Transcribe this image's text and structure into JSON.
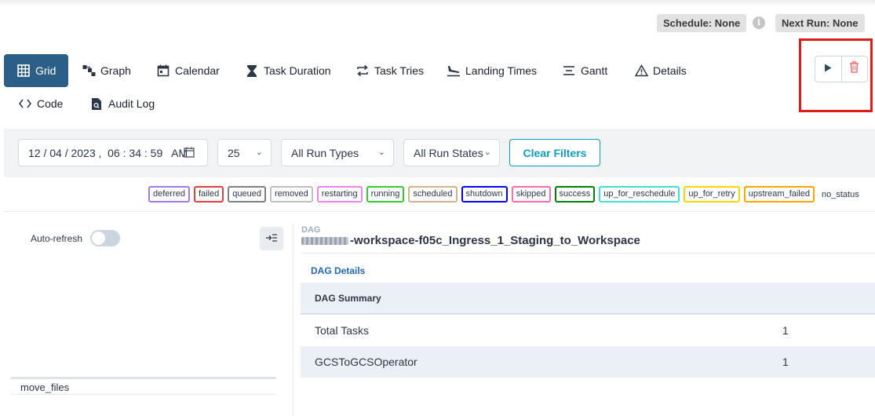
{
  "header": {
    "schedule": "Schedule: None",
    "next_run": "Next Run: None"
  },
  "nav": {
    "grid": "Grid",
    "graph": "Graph",
    "calendar": "Calendar",
    "task_duration": "Task Duration",
    "task_tries": "Task Tries",
    "landing_times": "Landing Times",
    "gantt": "Gantt",
    "details": "Details",
    "code": "Code",
    "audit_log": "Audit Log",
    "active": "Grid"
  },
  "filters": {
    "datetime": "12 / 04 / 2023 ,  06 : 34 : 59   AM",
    "num_runs": "25",
    "run_types": "All Run Types",
    "run_states": "All Run States",
    "clear": "Clear Filters"
  },
  "legend": {
    "states": [
      {
        "label": "deferred",
        "color": "#9f7aea"
      },
      {
        "label": "failed",
        "color": "#e53e3e"
      },
      {
        "label": "queued",
        "color": "#808080"
      },
      {
        "label": "removed",
        "color": "#c0c0c0"
      },
      {
        "label": "restarting",
        "color": "#ee82ee"
      },
      {
        "label": "running",
        "color": "#32cd32"
      },
      {
        "label": "scheduled",
        "color": "#d2b48c"
      },
      {
        "label": "shutdown",
        "color": "#0000ff"
      },
      {
        "label": "skipped",
        "color": "#ff69b4"
      },
      {
        "label": "success",
        "color": "#008000"
      },
      {
        "label": "up_for_reschedule",
        "color": "#40e0d0"
      },
      {
        "label": "up_for_retry",
        "color": "#ffd700"
      },
      {
        "label": "upstream_failed",
        "color": "#ffa500"
      }
    ],
    "no_status": "no_status"
  },
  "grid_panel": {
    "auto_refresh": "Auto-refresh",
    "auto_refresh_on": false,
    "task": "move_files"
  },
  "details_panel": {
    "dag_label": "DAG",
    "dag_id": "-workspace-f05c_Ingress_1_Staging_to_Workspace",
    "section_link": "DAG Details",
    "summary_header": "DAG Summary",
    "rows": [
      {
        "label": "Total Tasks",
        "value": "1"
      },
      {
        "label": "GCSToGCSOperator",
        "value": "1"
      }
    ]
  },
  "colors": {
    "accent": "#2b5f87",
    "clear_filters": "#0d9cc4",
    "highlight_box": "#e01b1b",
    "delete_icon": "#e86b6b"
  }
}
